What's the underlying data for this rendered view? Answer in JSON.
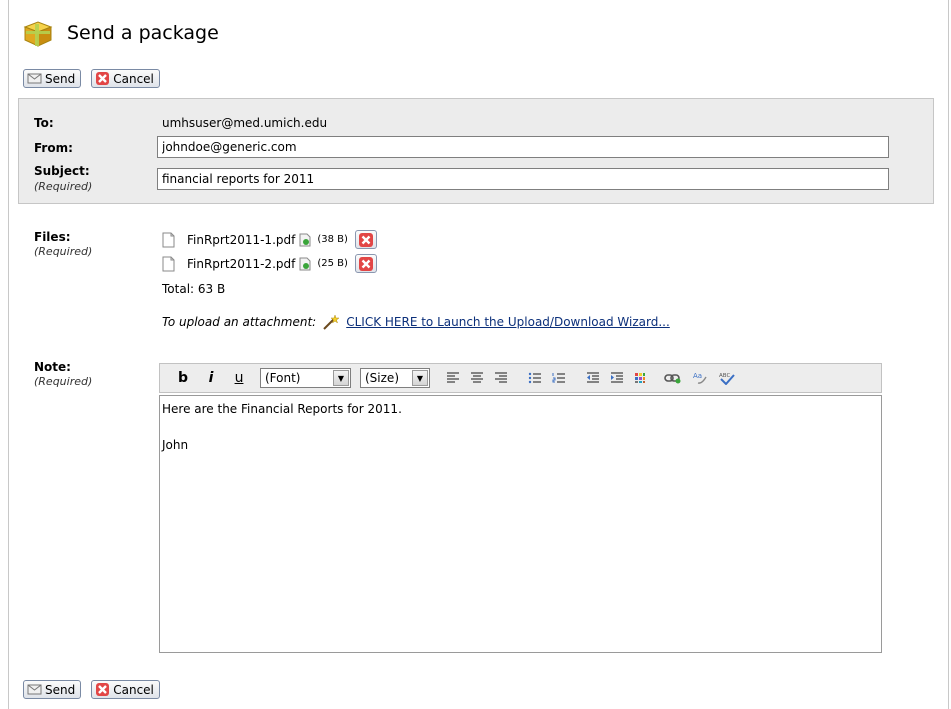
{
  "page": {
    "title": "Send a package",
    "package_icon": "package-icon"
  },
  "toolbar_top": {
    "send_label": "Send",
    "cancel_label": "Cancel"
  },
  "toolbar_bottom": {
    "send_label": "Send",
    "cancel_label": "Cancel"
  },
  "header": {
    "to_label": "To:",
    "to_value": "umhsuser@med.umich.edu",
    "from_label": "From:",
    "from_value": "johndoe@generic.com",
    "subject_label": "Subject:",
    "subject_required": "(Required)",
    "subject_value": "financial reports for 2011"
  },
  "files": {
    "label": "Files:",
    "required": "(Required)",
    "items": [
      {
        "name": "FinRprt2011-1.pdf",
        "size": "(38 B)"
      },
      {
        "name": "FinRprt2011-2.pdf",
        "size": "(25 B)"
      }
    ],
    "total": "Total: 63 B",
    "upload_prompt": "To upload an attachment:",
    "upload_link": "CLICK HERE to Launch the Upload/Download Wizard..."
  },
  "note": {
    "label": "Note:",
    "required": "(Required)",
    "toolbar": {
      "bold": "b",
      "italic": "i",
      "underline": "u",
      "font_select": "(Font)",
      "size_select": "(Size)"
    },
    "lines": [
      "Here are the Financial Reports for 2011.",
      "",
      "John"
    ]
  },
  "colors": {
    "accent_link": "#0b2f7a",
    "delete_red": "#cc2020",
    "header_bg": "#ececec"
  }
}
